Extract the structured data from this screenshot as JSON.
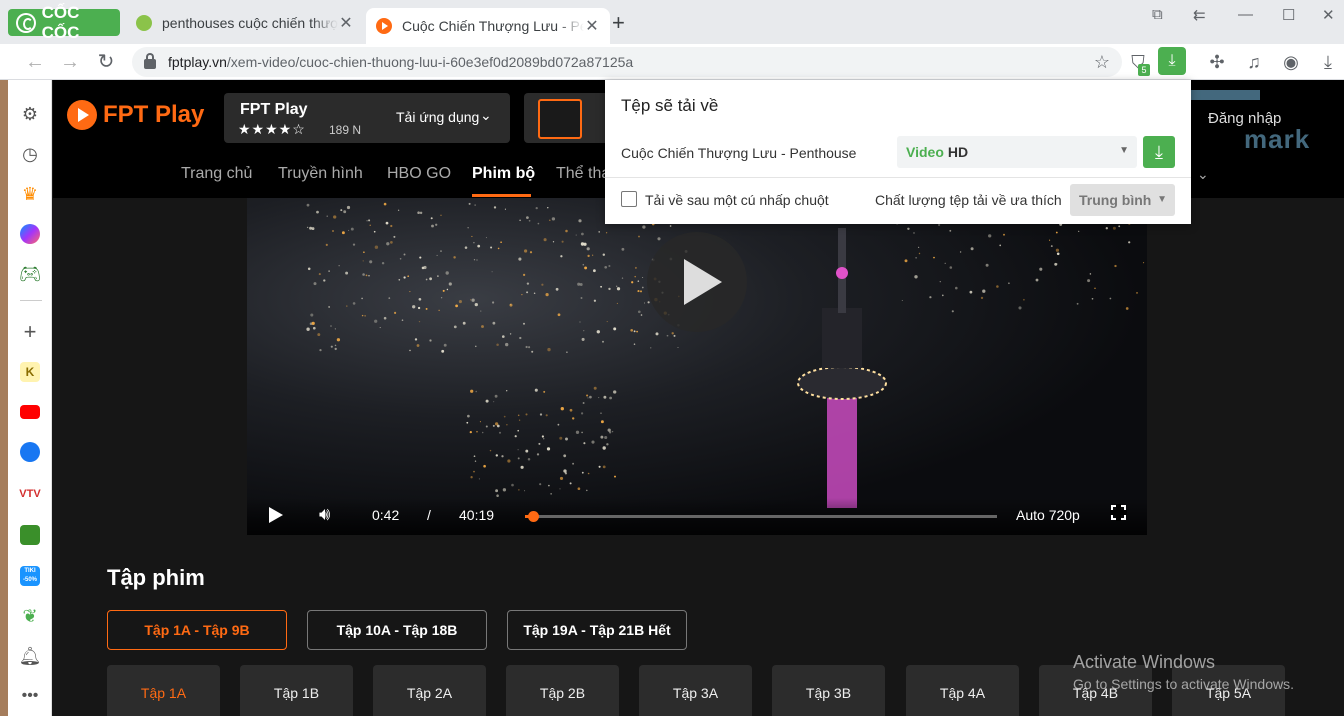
{
  "browser": {
    "brand": "CỐC CỐC",
    "tabs": [
      {
        "title": "penthouses cuộc chiến thượng lưu",
        "active": false
      },
      {
        "title": "Cuộc Chiến Thượng Lưu - Penthouse",
        "active": true
      }
    ],
    "url_domain": "fptplay.vn",
    "url_path": "/xem-video/cuoc-chien-thuong-luu-i-60e3ef0d2089bd072a87125a",
    "shield_badge": "5",
    "colors": {
      "brand_green": "#4caf50",
      "tab_bar": "#e8eaed"
    }
  },
  "sidebar": {
    "items": [
      "gear-icon",
      "history-icon",
      "crown-icon",
      "messenger-icon",
      "game-icon",
      "add-icon",
      "k-icon",
      "youtube-icon",
      "facebook-icon",
      "vtv-icon",
      "game2-icon",
      "tiki-icon",
      "leaf-icon",
      "bell-icon",
      "more-icon"
    ],
    "tiki_label": "TIKI -50%"
  },
  "site": {
    "logo": "FPT Play",
    "app_name": "FPT Play",
    "app_stars": "★★★★☆",
    "app_rating_count": "189 N",
    "app_download": "Tải ứng dụng",
    "login": "Đăng nhập",
    "nav": [
      "Trang chủ",
      "Truyền hình",
      "HBO GO",
      "Phim bộ",
      "Thể thao"
    ],
    "nav_active": "Phim bộ",
    "accent": "#ff6a13"
  },
  "player": {
    "current_time": "0:42",
    "separator": "/",
    "duration": "40:19",
    "progress_fraction": 0.017,
    "quality": "Auto 720p"
  },
  "episodes": {
    "title": "Tập phim",
    "ranges": [
      "Tập 1A - Tập 9B",
      "Tập 10A - Tập 18B",
      "Tập 19A - Tập 21B Hết"
    ],
    "active_range": 0,
    "items": [
      "Tập 1A",
      "Tập 1B",
      "Tập 2A",
      "Tập 2B",
      "Tập 3A",
      "Tập 3B",
      "Tập 4A",
      "Tập 4B",
      "Tập 5A"
    ],
    "active_item": 0
  },
  "download_popup": {
    "title": "Tệp sẽ tải về",
    "file_name": "Cuộc Chiến Thượng Lưu - Penthouse",
    "format_type": "Video",
    "format_quality": "HD",
    "auto_checkbox_label": "Tải về sau một cú nhấp chuột",
    "auto_checked": false,
    "pref_label": "Chất lượng tệp tải về ưa thích",
    "pref_value": "Trung bình"
  },
  "watermark": {
    "text": "mark"
  },
  "activate_windows": {
    "line1": "Activate Windows",
    "line2": "Go to Settings to activate Windows."
  }
}
